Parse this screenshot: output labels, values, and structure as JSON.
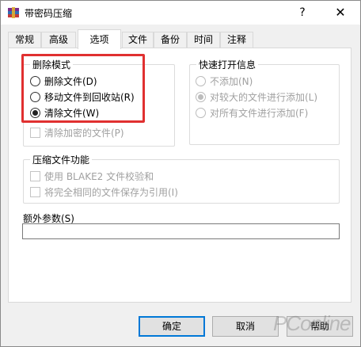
{
  "window": {
    "title": "带密码压缩",
    "help_label": "?",
    "close_label": "✕"
  },
  "tabs": [
    {
      "label": "常规",
      "active": false
    },
    {
      "label": "高级",
      "active": false
    },
    {
      "label": "选项",
      "active": true
    },
    {
      "label": "文件",
      "active": false
    },
    {
      "label": "备份",
      "active": false
    },
    {
      "label": "时间",
      "active": false
    },
    {
      "label": "注释",
      "active": false
    }
  ],
  "delete_mode": {
    "title": "删除模式",
    "options": [
      {
        "label": "删除文件(D)",
        "checked": false
      },
      {
        "label": "移动文件到回收站(R)",
        "checked": false
      },
      {
        "label": "清除文件(W)",
        "checked": true
      }
    ],
    "wipe_encrypted_label": "清除加密的文件(P)"
  },
  "quick_open": {
    "title": "快速打开信息",
    "options": [
      {
        "label": "不添加(N)",
        "checked": false
      },
      {
        "label": "对较大的文件进行添加(L)",
        "checked": true
      },
      {
        "label": "对所有文件进行添加(F)",
        "checked": false
      }
    ]
  },
  "compress_features": {
    "title": "压缩文件功能",
    "blake2_label": "使用 BLAKE2 文件校验和",
    "identical_label": "将完全相同的文件保存为引用(I)"
  },
  "params": {
    "label": "额外参数(S)",
    "value": ""
  },
  "buttons": {
    "ok": "确定",
    "cancel": "取消",
    "help": "帮助"
  },
  "watermark": "PConline"
}
